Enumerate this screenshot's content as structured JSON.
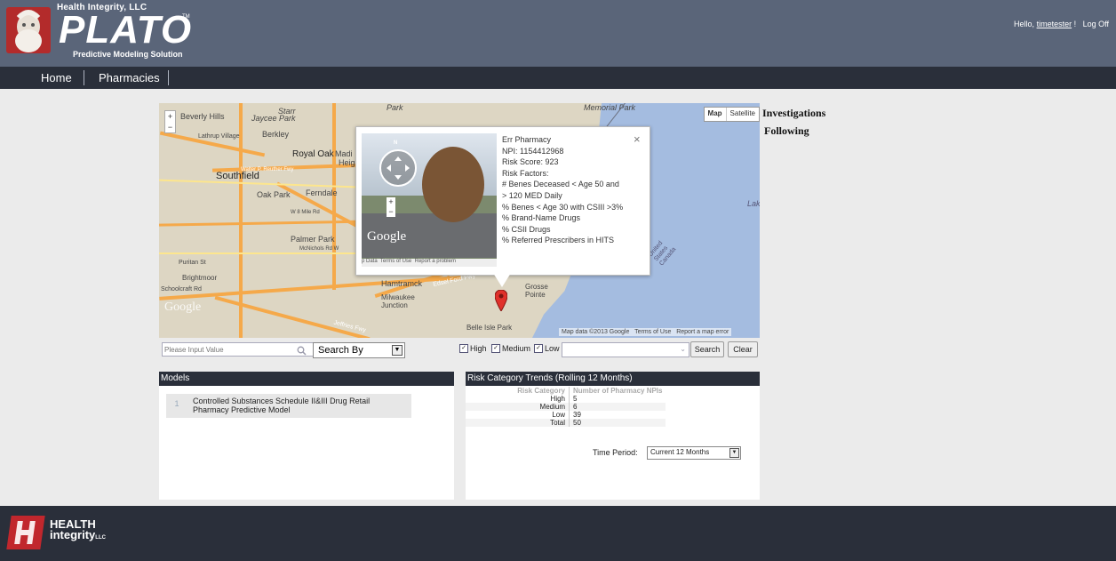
{
  "header": {
    "company": "Health Integrity, LLC",
    "product": "PLATO",
    "tm": "TM",
    "tagline": "Predictive Modeling Solution",
    "greeting": "Hello,",
    "username": "timetester",
    "greeting_end": "!",
    "logoff": "Log Off"
  },
  "nav": {
    "items": [
      "Home",
      "Pharmacies"
    ]
  },
  "map": {
    "type_buttons": [
      "Map",
      "Satellite"
    ],
    "labels": [
      "Beverly Hills",
      "Jaycee Park",
      "Starr",
      "Berkley",
      "Lathrup Village",
      "Royal Oak",
      "Madi",
      "Heig",
      "Walter P. Reuther Fwy",
      "Southfield",
      "Oak Park",
      "Ferndale",
      "W 8 Mile Rd",
      "Palmer Park",
      "McNichols Rd W",
      "Puritan St",
      "Brightmoor",
      "Schoolcraft Rd",
      "Hamtramck",
      "Milwaukee Junction",
      "Edsel Ford Fwy",
      "Grosse Pointe",
      "Belle Isle Park",
      "Memorial Park",
      "Lak",
      "United States Canada",
      "Jeffries Fwy",
      "Park"
    ],
    "footer": [
      "Map data ©2013 Google",
      "Terms of Use",
      "Report a map error"
    ],
    "google_watermark": "Google"
  },
  "popup": {
    "name": "Err Pharmacy",
    "npi": "NPI: 1154412968",
    "risk_score": "Risk Score: 923",
    "risk_factors_title": "Risk Factors:",
    "risk_factors": [
      "# Benes Deceased < Age 50 and",
      "> 120 MED Daily",
      "% Benes < Age 30 with CSIII >3%",
      "% Brand-Name Drugs",
      "% CSII Drugs",
      "% Referred Prescribers in HITS"
    ],
    "close": "×",
    "sv_google": "Google",
    "sv_footer": [
      "p Data",
      "Terms of Use",
      "Report a problem"
    ],
    "sv_compass_n": "N"
  },
  "side_links": [
    "Investigations",
    "Following"
  ],
  "search": {
    "placeholder": "Please Input Value",
    "search_by": "Search By",
    "filters": [
      {
        "label": "High",
        "checked": true
      },
      {
        "label": "Medium",
        "checked": true
      },
      {
        "label": "Low",
        "checked": true
      }
    ],
    "search_button": "Search",
    "clear_button": "Clear"
  },
  "models": {
    "title": "Models",
    "rows": [
      {
        "index": "1",
        "name": "Controlled Substances Schedule II&III Drug Retail Pharmacy Predictive Model"
      }
    ]
  },
  "trends": {
    "title": "Risk Category Trends (Rolling 12 Months)",
    "col_category": "Risk Category",
    "col_count": "Number of Pharmacy NPIs",
    "rows": [
      {
        "category": "High",
        "count": "5"
      },
      {
        "category": "Medium",
        "count": "6"
      },
      {
        "category": "Low",
        "count": "39"
      },
      {
        "category": "Total",
        "count": "50"
      }
    ],
    "time_label": "Time Period:",
    "time_value": "Current 12 Months"
  },
  "footer": {
    "brand_line1": "HEALTH",
    "brand_line2": "integrity",
    "brand_suffix": "LLC"
  },
  "colors": {
    "header_bg": "#5a6579",
    "nav_bg": "#2a2f3a",
    "accent_red": "#c1272d",
    "page_bg": "#ebebeb"
  }
}
